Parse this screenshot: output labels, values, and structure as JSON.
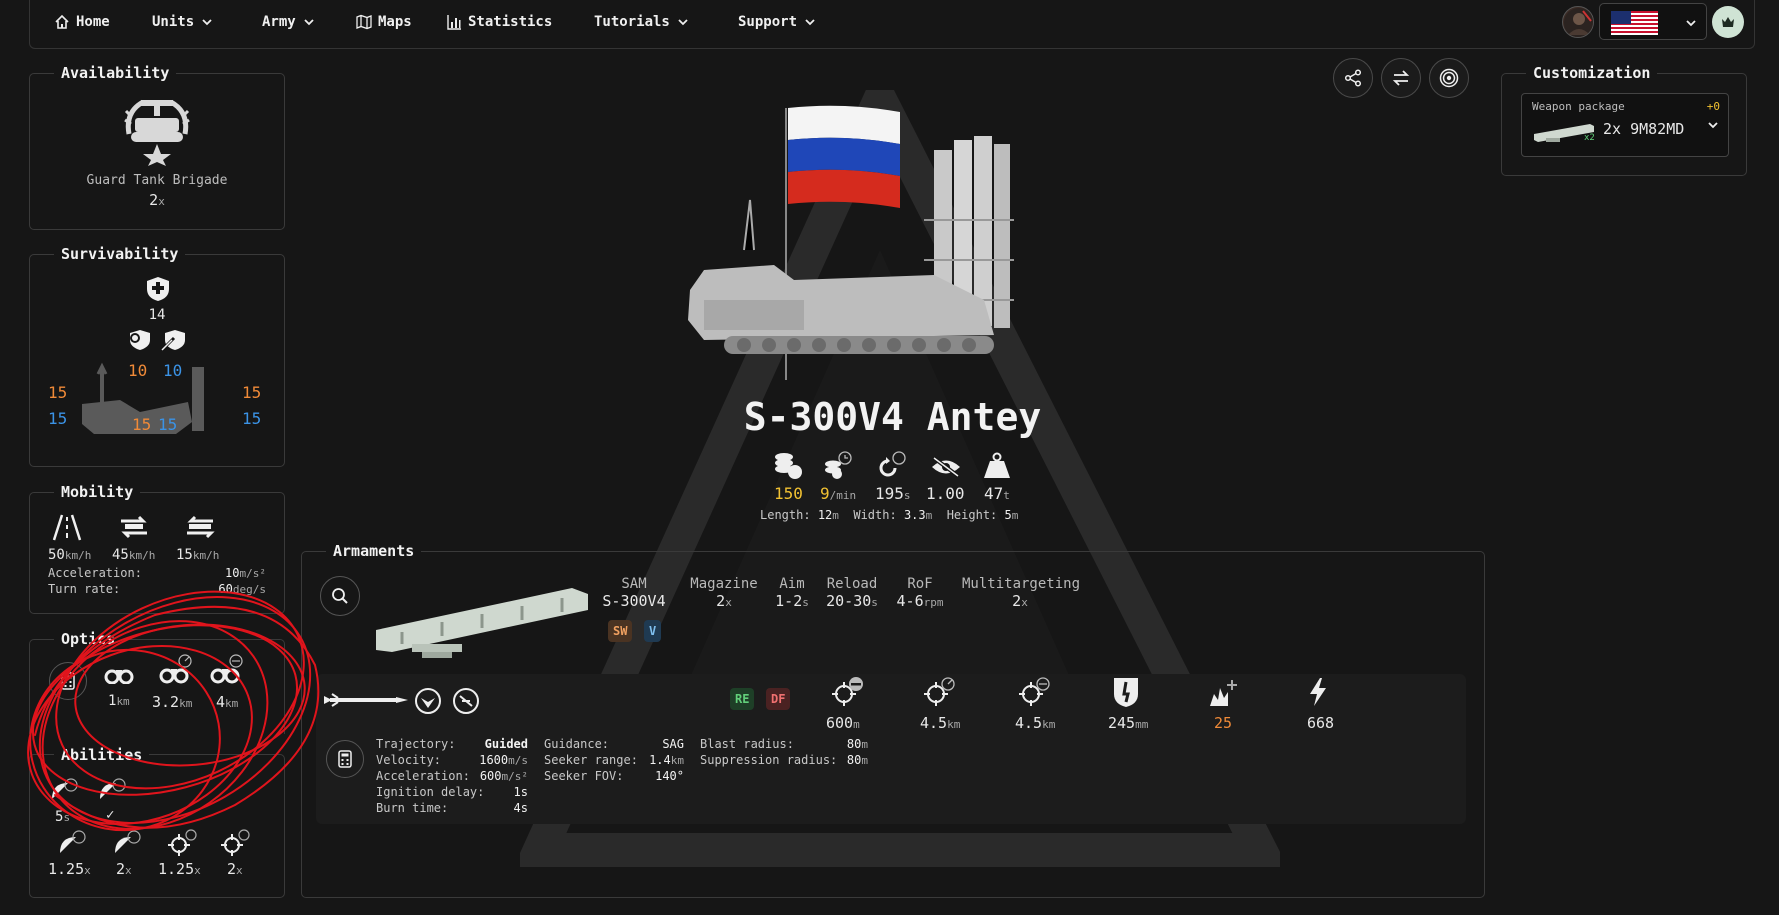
{
  "nav": {
    "home": "Home",
    "units": "Units",
    "army": "Army",
    "maps": "Maps",
    "statistics": "Statistics",
    "tutorials": "Tutorials",
    "support": "Support"
  },
  "availability": {
    "title": "Availability",
    "brigade": "Guard Tank Brigade",
    "count": "2",
    "count_unit": "x"
  },
  "survivability": {
    "title": "Survivability",
    "hp": "14",
    "he_resist": "10",
    "kinetic_resist": "10",
    "left_orange": "15",
    "left_blue": "15",
    "right_orange": "15",
    "right_blue": "15",
    "bottom_orange": "15",
    "bottom_blue": "15"
  },
  "mobility": {
    "title": "Mobility",
    "road_speed": "50",
    "offroad_speed": "45",
    "reverse_speed": "15",
    "speed_unit": "km/h",
    "acceleration_label": "Acceleration:",
    "acceleration_value": "10",
    "acceleration_unit": "m/s²",
    "turn_rate_label": "Turn rate:",
    "turn_rate_value": "60",
    "turn_rate_unit": "deg/s"
  },
  "optics": {
    "title": "Optics",
    "values": [
      {
        "value": "1",
        "unit": "km"
      },
      {
        "value": "3.2",
        "unit": "km"
      },
      {
        "value": "4",
        "unit": "km"
      }
    ]
  },
  "abilities": {
    "title": "Abilities",
    "row1": [
      {
        "value": "5",
        "unit": "s"
      },
      {
        "value": "✓",
        "unit": ""
      }
    ],
    "row2": [
      {
        "value": "1.25",
        "unit": "x"
      },
      {
        "value": "2",
        "unit": "x"
      },
      {
        "value": "1.25",
        "unit": "x"
      },
      {
        "value": "2",
        "unit": "x"
      }
    ]
  },
  "unit": {
    "name": "S-300V4 Antey",
    "cost": "150",
    "income": "9",
    "income_unit": "/min",
    "respawn": "195",
    "respawn_unit": "s",
    "stealth": "1.00",
    "weight": "47",
    "weight_unit": "t",
    "length_label": "Length:",
    "length": "12",
    "width_label": "Width:",
    "width": "3.3",
    "height_label": "Height:",
    "height": "5",
    "dim_unit": "m"
  },
  "armaments": {
    "title": "Armaments",
    "headers": {
      "type": "SAM",
      "magazine": "Magazine",
      "aim": "Aim",
      "reload": "Reload",
      "rof": "RoF",
      "multitargeting": "Multitargeting"
    },
    "values": {
      "type": "S-300V4",
      "magazine": "2",
      "magazine_unit": "x",
      "aim": "1-2",
      "aim_unit": "s",
      "reload": "20-30",
      "reload_unit": "s",
      "rof": "4-6",
      "rof_unit": "rpm",
      "multitargeting": "2",
      "multitargeting_unit": "x"
    },
    "tags": [
      "SW",
      "V"
    ],
    "missile_tags": [
      "RE",
      "DF"
    ],
    "ranges": [
      {
        "value": "600",
        "unit": "m"
      },
      {
        "value": "4.5",
        "unit": "km"
      },
      {
        "value": "4.5",
        "unit": "km"
      }
    ],
    "penetration": "245",
    "penetration_unit": "mm",
    "damage": "25",
    "power": "668",
    "details": {
      "trajectory_label": "Trajectory:",
      "trajectory": "Guided",
      "velocity_label": "Velocity:",
      "velocity": "1600",
      "velocity_unit": "m/s",
      "acceleration_label": "Acceleration:",
      "acceleration": "600",
      "acceleration_unit": "m/s²",
      "ignition_label": "Ignition delay:",
      "ignition": "1s",
      "burn_label": "Burn time:",
      "burn": "4s",
      "guidance_label": "Guidance:",
      "guidance": "SAG",
      "seeker_range_label": "Seeker range:",
      "seeker_range": "1.4",
      "seeker_range_unit": "km",
      "seeker_fov_label": "Seeker FOV:",
      "seeker_fov": "140°",
      "blast_label": "Blast radius:",
      "blast": "80",
      "blast_unit": "m",
      "suppression_label": "Suppression radius:",
      "suppression": "80",
      "suppression_unit": "m"
    }
  },
  "customization": {
    "title": "Customization",
    "weapon_package_label": "Weapon package",
    "weapon_package_value": "2x 9M82MD",
    "weapon_package_cost": "+0",
    "thumb_badge": "x2"
  },
  "colors": {
    "accent_orange": "#f08a38",
    "accent_blue": "#3b93e6",
    "accent_yellow": "#f2c232",
    "annotation_red": "#e0141c"
  }
}
